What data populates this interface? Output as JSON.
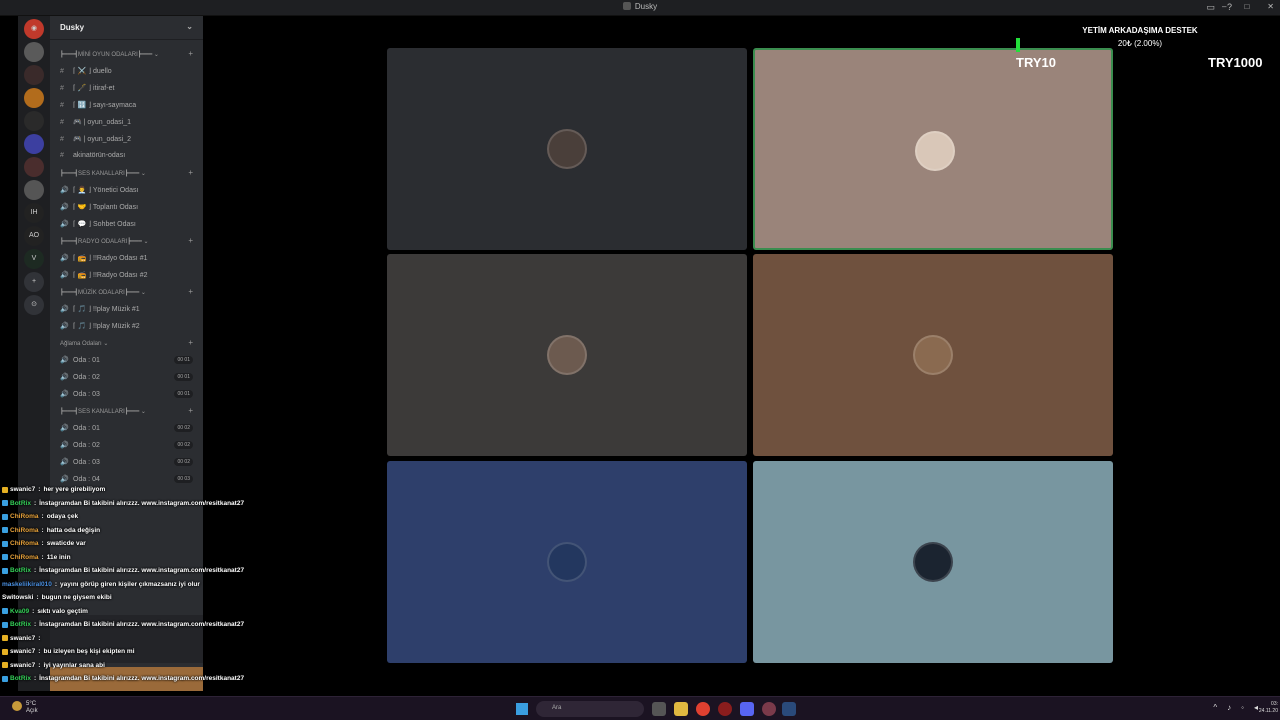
{
  "window": {
    "title": "Dusky"
  },
  "guild": {
    "name": "Dusky"
  },
  "channels": [
    {
      "type": "cat",
      "label": "┣━━━┫MİNİ OYUN ODALARI┣━━━ ⌄"
    },
    {
      "type": "text",
      "label": "⌈ ⚔️ ⌋ duello"
    },
    {
      "type": "text",
      "label": "⌈ 🖋️ ⌋ itiraf-et"
    },
    {
      "type": "text",
      "label": "⌈ 🔢 ⌋ sayı-saymaca"
    },
    {
      "type": "text",
      "label": "🎮 | oyun_odasi_1"
    },
    {
      "type": "text",
      "label": "🎮 | oyun_odasi_2"
    },
    {
      "type": "text",
      "label": "akinatörün-odası"
    },
    {
      "type": "cat",
      "label": "┣━━━┫SES KANALLARI┣━━━ ⌄"
    },
    {
      "type": "voice",
      "label": "⌈ 👨‍💼 ⌋ Yönetici Odası"
    },
    {
      "type": "voice",
      "label": "⌈ 🤝 ⌋ Toplantı Odası"
    },
    {
      "type": "voice",
      "label": "⌈ 💬 ⌋ Sohbet Odası"
    },
    {
      "type": "cat",
      "label": "┣━━━┫RADYO ODALARI┣━━━ ⌄"
    },
    {
      "type": "voice",
      "label": "⌈ 📻 ⌋ !!Radyo Odası #1"
    },
    {
      "type": "voice",
      "label": "⌈ 📻 ⌋ !!Radyo Odası #2"
    },
    {
      "type": "cat",
      "label": "┣━━━┫MÜZİK ODALARI┣━━━ ⌄"
    },
    {
      "type": "voice",
      "label": "⌈ 🎵 ⌋ !!play Müzik #1"
    },
    {
      "type": "voice",
      "label": "⌈ 🎵 ⌋ !!play Müzik #2"
    },
    {
      "type": "cat",
      "label": "Ağlama Odaları ⌄"
    },
    {
      "type": "voice",
      "label": "Oda : 01",
      "count": "00 01"
    },
    {
      "type": "voice",
      "label": "Oda : 02",
      "count": "00 01"
    },
    {
      "type": "voice",
      "label": "Oda : 03",
      "count": "00 01"
    },
    {
      "type": "cat",
      "label": "┣━━━┫SES KANALLARI┣━━━ ⌄"
    },
    {
      "type": "voice",
      "label": "Oda : 01",
      "count": "00 02"
    },
    {
      "type": "voice",
      "label": "Oda : 02",
      "count": "00 02"
    },
    {
      "type": "voice",
      "label": "Oda : 03",
      "count": "00 02"
    },
    {
      "type": "voice",
      "label": "Oda : 04",
      "count": "00 03"
    }
  ],
  "donation": {
    "title": "YETİM ARKADAŞIMA DESTEK",
    "amount": "20₺ (2.00%)",
    "goal_fraction": 0.02,
    "low": "TRY10",
    "high": "TRY1000"
  },
  "tiles": [
    {
      "color": "#2b2d31",
      "avatar": "#4a3f3a",
      "speaking": false
    },
    {
      "color": "#9a847a",
      "avatar": "#d9c7b8",
      "speaking": true
    },
    {
      "color": "#3c3a39",
      "avatar": "#6c5a4f",
      "speaking": false
    },
    {
      "color": "#6f513e",
      "avatar": "#8a6a50",
      "speaking": false
    },
    {
      "color": "#2e3f6b",
      "avatar": "#23375f",
      "speaking": false
    },
    {
      "color": "#7896a0",
      "avatar": "#1b2430",
      "speaking": false
    }
  ],
  "chat": [
    {
      "badge": "#e5b023",
      "user": "swanic7",
      "ucolor": "#ffffff",
      "text": "her yere girebiliyom"
    },
    {
      "badge": "#3aa0e0",
      "user": "BotRix",
      "ucolor": "#34d058",
      "text": "İnstagramdan Bi takibini alırızzz. www.instagram.com/resitkanat27"
    },
    {
      "badge": "#3aa0e0",
      "user": "ChiRoma",
      "ucolor": "#e8a23a",
      "text": "odaya çek"
    },
    {
      "badge": "#3aa0e0",
      "user": "ChiRoma",
      "ucolor": "#e8a23a",
      "text": "hatta oda değişin"
    },
    {
      "badge": "#3aa0e0",
      "user": "ChiRoma",
      "ucolor": "#e8a23a",
      "text": "swaticde var"
    },
    {
      "badge": "#3aa0e0",
      "user": "ChiRoma",
      "ucolor": "#e8a23a",
      "text": "11e inin"
    },
    {
      "badge": "#3aa0e0",
      "user": "BotRix",
      "ucolor": "#34d058",
      "text": "İnstagramdan Bi takibini alırızzz. www.instagram.com/resitkanat27"
    },
    {
      "badge": "",
      "user": "maskeliikiral010",
      "ucolor": "#4a90e2",
      "text": "yayını görüp giren kişiler çıkmazsanız iyi olur"
    },
    {
      "badge": "",
      "user": "Switowski",
      "ucolor": "#ffffff",
      "text": "bugun ne giysem ekibi"
    },
    {
      "badge": "#3aa0e0",
      "user": "Kva09",
      "ucolor": "#34d058",
      "text": "sıktı valo geçtim"
    },
    {
      "badge": "#3aa0e0",
      "user": "BotRix",
      "ucolor": "#34d058",
      "text": "İnstagramdan Bi takibini alırızzz. www.instagram.com/resitkanat27"
    },
    {
      "badge": "#e5b023",
      "user": "swanic7",
      "ucolor": "#ffffff",
      "text": ""
    },
    {
      "badge": "#e5b023",
      "user": "swanic7",
      "ucolor": "#ffffff",
      "text": "bu izleyen beş kişi ekipten mi"
    },
    {
      "badge": "#e5b023",
      "user": "swanic7",
      "ucolor": "#ffffff",
      "text": "iyi yayınlar sana abi"
    },
    {
      "badge": "#3aa0e0",
      "user": "BotRix",
      "ucolor": "#34d058",
      "text": "İnstagramdan Bi takibini alırızzz. www.instagram.com/resitkanat27"
    }
  ],
  "taskbar": {
    "weather_temp": "5°C",
    "weather_text": "Açık",
    "search_placeholder": "Ara",
    "time": "03:",
    "date": "24.11.20"
  }
}
